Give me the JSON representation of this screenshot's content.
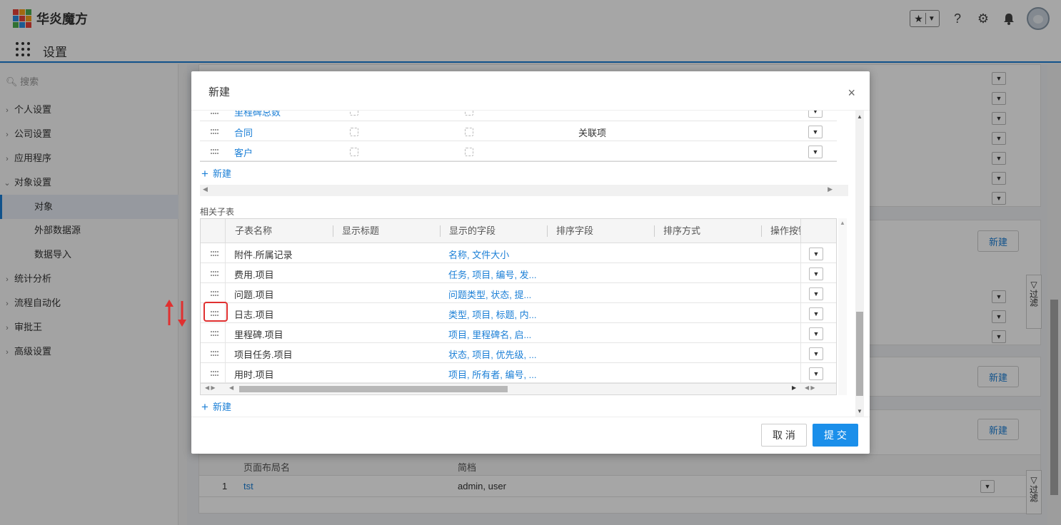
{
  "app": {
    "brand": "华炎魔方",
    "title": "设置"
  },
  "sidebar": {
    "search_placeholder": "搜索",
    "items": [
      {
        "label": "个人设置",
        "chev": "›"
      },
      {
        "label": "公司设置",
        "chev": "›"
      },
      {
        "label": "应用程序",
        "chev": "›"
      },
      {
        "label": "对象设置",
        "chev": "⌄"
      },
      {
        "label": "对象"
      },
      {
        "label": "外部数据源"
      },
      {
        "label": "数据导入"
      },
      {
        "label": "统计分析",
        "chev": "›"
      },
      {
        "label": "流程自动化",
        "chev": "›"
      },
      {
        "label": "审批王",
        "chev": "›"
      },
      {
        "label": "高级设置",
        "chev": "›"
      }
    ]
  },
  "background": {
    "new_label": "新建",
    "filter_label": "过滤",
    "layout_table": {
      "columns": [
        "页面布局名",
        "简档"
      ],
      "rows": [
        {
          "index": "1",
          "name": "tst",
          "profiles": "admin, user"
        }
      ]
    }
  },
  "modal": {
    "title": "新建",
    "close": "×",
    "upper_rows": [
      {
        "name": "里程碑总数",
        "extra": ""
      },
      {
        "name": "合同",
        "extra": "关联项"
      },
      {
        "name": "客户",
        "extra": ""
      }
    ],
    "new_label": "新建",
    "related_label": "相关子表",
    "subgrid": {
      "columns": [
        "子表名称",
        "显示标题",
        "显示的字段",
        "排序字段",
        "排序方式",
        "操作按钮"
      ],
      "rows": [
        {
          "name": "附件.所属记录",
          "fields": "名称, 文件大小"
        },
        {
          "name": "费用.项目",
          "fields": "任务, 项目, 编号, 发..."
        },
        {
          "name": "问题.项目",
          "fields": "问题类型, 状态, 提..."
        },
        {
          "name": "日志.项目",
          "fields": "类型, 项目, 标题, 内..."
        },
        {
          "name": "里程碑.项目",
          "fields": "项目, 里程碑名, 启..."
        },
        {
          "name": "项目任务.项目",
          "fields": "状态, 项目, 优先级, ..."
        },
        {
          "name": "用时.项目",
          "fields": "项目, 所有者, 编号, ..."
        }
      ]
    },
    "cancel_label": "取 消",
    "submit_label": "提 交"
  },
  "colors": {
    "accent": "#1b8fea",
    "link": "#1b7fd6",
    "highlight": "#e03030"
  }
}
